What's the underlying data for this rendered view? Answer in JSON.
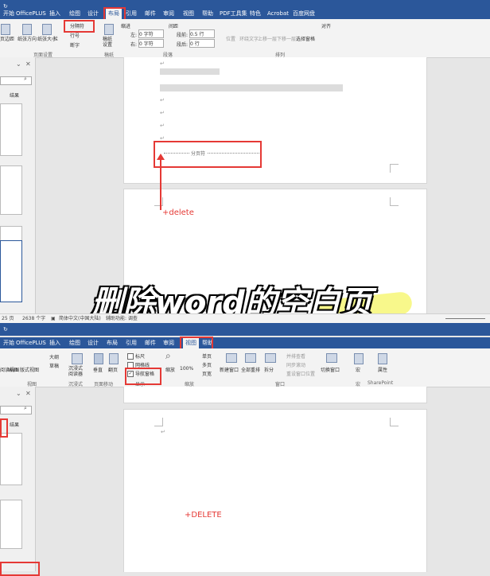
{
  "tabs_top": [
    "开始",
    "OfficePLUS",
    "插入",
    "绘图",
    "设计",
    "布局",
    "引用",
    "邮件",
    "审阅",
    "视图",
    "帮助",
    "PDF工具集",
    "特色",
    "Acrobat",
    "百度网盘"
  ],
  "tabs_bottom": [
    "开始",
    "OfficePLUS",
    "插入",
    "绘图",
    "设计",
    "布局",
    "引用",
    "邮件",
    "审阅",
    "视图",
    "帮助"
  ],
  "ribbon_top": {
    "btn_margins": "页边距",
    "btn_orientation": "纸张方向",
    "btn_size": "纸张大小",
    "btn_columns": "栏",
    "breaks": "分隔符",
    "line_numbers": "行号",
    "hyphenation": "断字",
    "group_page_setup": "页面设置",
    "draft_btn": "稿纸设置",
    "group_draft": "稿纸",
    "indent_label": "缩进",
    "indent_left_label": "左:",
    "indent_left_value": "0 字符",
    "indent_right_label": "右:",
    "indent_right_value": "0 字符",
    "spacing_label": "间距",
    "spacing_before_label": "段前:",
    "spacing_before_value": "0.5 行",
    "spacing_after_label": "段后:",
    "spacing_after_value": "0 行",
    "group_paragraph": "段落",
    "position": "位置",
    "wrap_text": "环绕文字",
    "bring_forward": "上移一层",
    "send_backward": "下移一层",
    "selection_pane": "选择窗格",
    "align": "对齐",
    "group_arrange": "排列"
  },
  "nav_top": {
    "tab_results": "结果"
  },
  "doc_top": {
    "section_break_label": "分页符",
    "annotation": "+delete"
  },
  "overlay_title": "删除word的空白页",
  "status": {
    "word_count": "2638 个字",
    "language": "简体中文(中国大陆)",
    "accessibility": "辅助功能: 调查"
  },
  "ribbon_bottom": {
    "read_mode": "阅读视图",
    "print_layout": "页面视图",
    "web_layout": "Web 版式视图",
    "outline": "大纲",
    "draft": "草稿",
    "group_views": "视图",
    "immersive_reader": "沉浸式阅读器",
    "group_immersive": "沉浸式",
    "vertical": "垂直",
    "side_to_side": "翻页",
    "group_page_move": "页面移动",
    "ruler": "标尺",
    "gridlines": "网格线",
    "nav_pane": "导航窗格",
    "group_show": "显示",
    "zoom": "缩放",
    "zoom_100": "100%",
    "one_page": "单页",
    "multi_page": "多页",
    "page_width": "页宽",
    "group_zoom": "缩放",
    "new_window": "新建窗口",
    "arrange_all": "全部重排",
    "split": "拆分",
    "side_by_side": "并排查看",
    "sync_scroll": "同步滚动",
    "reset_window": "重设窗口位置",
    "switch_windows": "切换窗口",
    "group_window": "窗口",
    "macros": "宏",
    "group_macros": "宏",
    "sharepoint": "属性",
    "group_sharepoint": "SharePoint"
  },
  "nav_bottom": {
    "tab_results": "结果"
  },
  "doc_bottom": {
    "annotation": "+DELETE"
  }
}
